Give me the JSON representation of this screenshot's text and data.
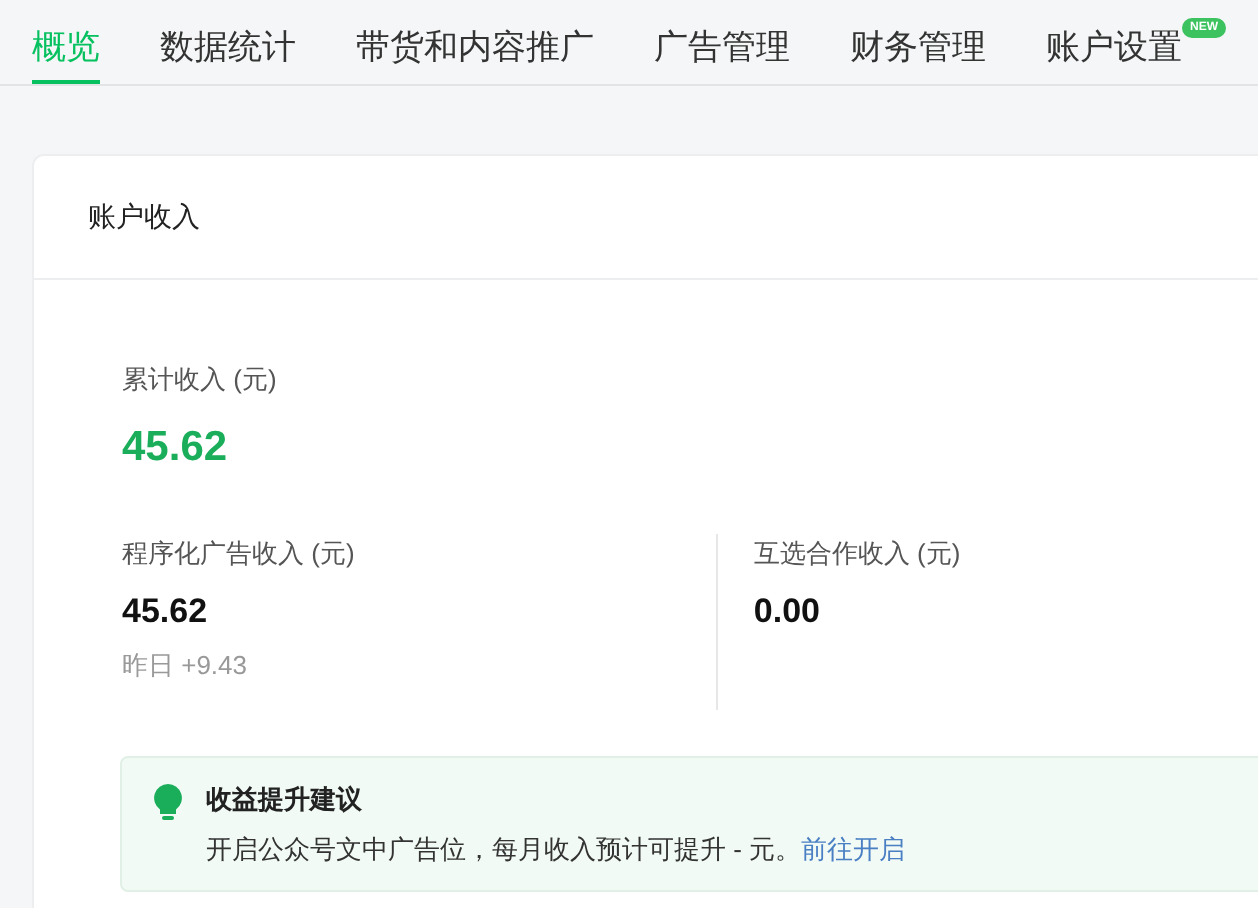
{
  "tabs": [
    {
      "label": "概览",
      "selected": true
    },
    {
      "label": "数据统计",
      "selected": false
    },
    {
      "label": "带货和内容推广",
      "selected": false
    },
    {
      "label": "广告管理",
      "selected": false
    },
    {
      "label": "财务管理",
      "selected": false
    },
    {
      "label": "账户设置",
      "selected": false,
      "badge": "NEW"
    }
  ],
  "card": {
    "title": "账户收入",
    "total": {
      "label": "累计收入 (元)",
      "value": "45.62"
    },
    "breakdown": [
      {
        "label": "程序化广告收入 (元)",
        "value": "45.62",
        "note": "昨日 +9.43"
      },
      {
        "label": "互选合作收入 (元)",
        "value": "0.00"
      }
    ],
    "tip": {
      "title": "收益提升建议",
      "text": "开启公众号文中广告位，每月收入预计可提升 - 元。",
      "link": "前往开启"
    }
  }
}
